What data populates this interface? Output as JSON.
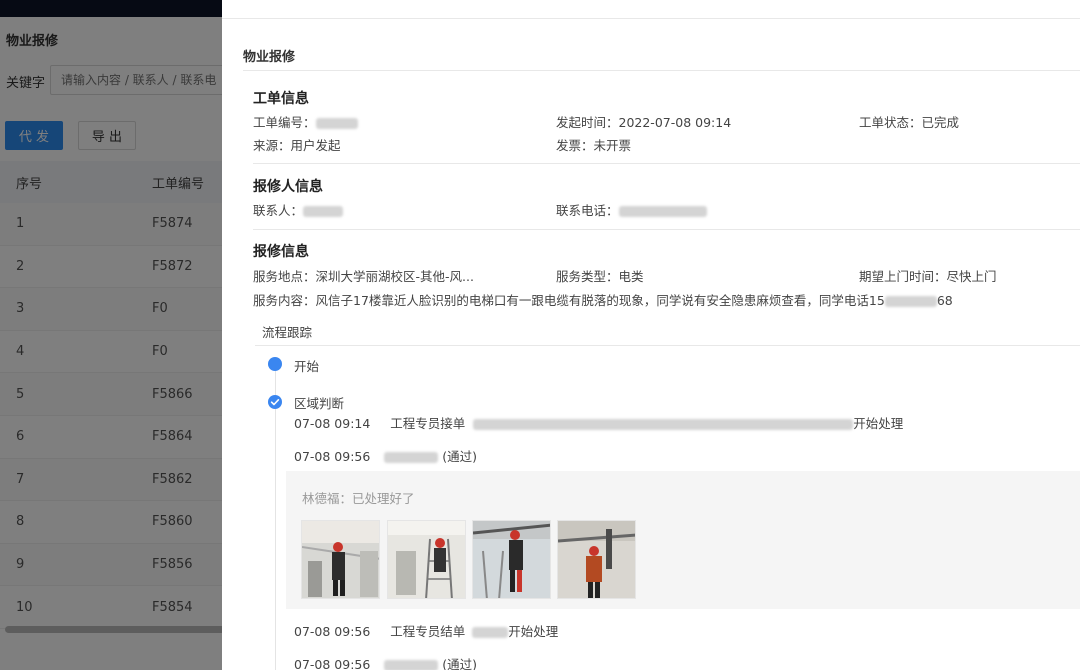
{
  "background": {
    "title": "物业报修",
    "keyword_label": "关键字",
    "search_placeholder": "请输入内容 / 联系人 / 联系电",
    "btn_daifa": "代 发",
    "btn_export": "导 出",
    "table": {
      "headers": [
        "序号",
        "工单编号"
      ],
      "rows": [
        [
          "1",
          "F5874"
        ],
        [
          "2",
          "F5872"
        ],
        [
          "3",
          "F0"
        ],
        [
          "4",
          "F0"
        ],
        [
          "5",
          "F5866"
        ],
        [
          "6",
          "F5864"
        ],
        [
          "7",
          "F5862"
        ],
        [
          "8",
          "F5860"
        ],
        [
          "9",
          "F5856"
        ],
        [
          "10",
          "F5854"
        ]
      ]
    }
  },
  "drawer": {
    "title": "物业报修",
    "work_order": {
      "title": "工单信息",
      "order_no_label": "工单编号：",
      "start_time": "发起时间：2022-07-08 09:14",
      "status": "工单状态：已完成",
      "source": "来源：用户发起",
      "invoice": "发票：未开票"
    },
    "reporter": {
      "title": "报修人信息",
      "contact_label": "联系人：",
      "phone_label": "联系电话："
    },
    "repair": {
      "title": "报修信息",
      "location": "服务地点：深圳大学丽湖校区-其他-风...",
      "service_type": "服务类型：电类",
      "expected_time": "期望上门时间：尽快上门",
      "content_prefix": "服务内容：风信子17楼靠近人脸识别的电梯口有一跟电缆有脱落的现象，同学说有安全隐患麻烦查看，同学电话15",
      "content_suffix": "68"
    },
    "flow": {
      "label": "流程跟踪",
      "start": "开始",
      "region": "区域判断",
      "e1_time": "07-08 09:14",
      "e1_action": "工程专员接单",
      "e1_tail": "开始处理",
      "e2_time": "07-08 09:56",
      "e2_result": "(通过)",
      "comment": "林德福：已处理好了",
      "e3_time": "07-08 09:56",
      "e3_action": "工程专员结单",
      "e3_tail": "开始处理",
      "e4_time": "07-08 09:56",
      "e4_result": "(通过)"
    }
  }
}
